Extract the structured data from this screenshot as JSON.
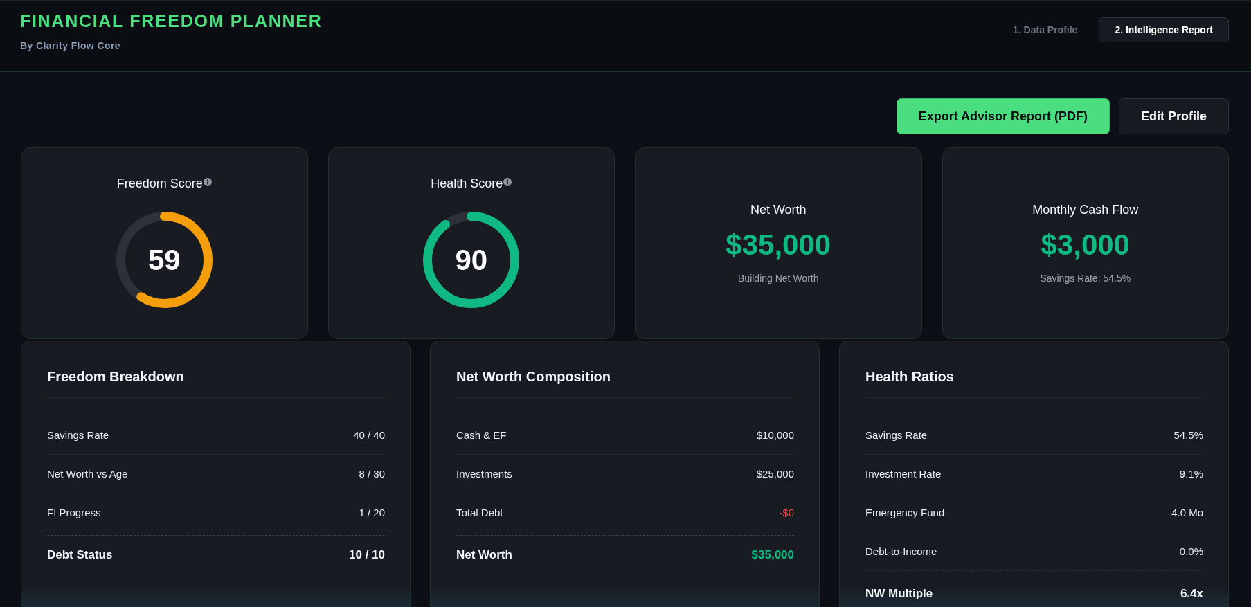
{
  "header": {
    "title": "FINANCIAL FREEDOM PLANNER",
    "subtitle": "By Clarity Flow Core"
  },
  "tabs": [
    {
      "label": "1. Data Profile",
      "selected": false
    },
    {
      "label": "2. Intelligence Report",
      "selected": true
    }
  ],
  "actions": [
    {
      "label": "Export Advisor Report (PDF)",
      "kind": "primary"
    },
    {
      "label": "Edit Profile",
      "kind": "secondary"
    }
  ],
  "score_cards": [
    {
      "kind": "gauge",
      "title": "Freedom Score",
      "info": true,
      "value": "59",
      "level": 0.59,
      "color": "#f59e0b"
    },
    {
      "kind": "gauge",
      "title": "Health Score",
      "info": true,
      "value": "90",
      "level": 0.9,
      "color": "#10b981"
    },
    {
      "kind": "stat",
      "title": "Net Worth",
      "value": "$35,000",
      "caption": "Building Net Worth"
    },
    {
      "kind": "stat",
      "title": "Monthly Cash Flow",
      "value": "$3,000",
      "caption": "Savings Rate: 54.5%"
    }
  ],
  "panels": [
    {
      "title": "Freedom Breakdown",
      "rows": [
        {
          "label": "Savings Rate",
          "value": "40 / 40",
          "negative": false
        },
        {
          "label": "Net Worth vs Age",
          "value": "8 / 30",
          "negative": false
        },
        {
          "label": "FI Progress",
          "value": "1 / 20",
          "negative": false
        }
      ],
      "total": {
        "label": "Debt Status",
        "value": "10 / 10",
        "positive": false
      }
    },
    {
      "title": "Net Worth Composition",
      "rows": [
        {
          "label": "Cash & EF",
          "value": "$10,000",
          "negative": false
        },
        {
          "label": "Investments",
          "value": "$25,000",
          "negative": false
        },
        {
          "label": "Total Debt",
          "value": "-$0",
          "negative": true
        }
      ],
      "total": {
        "label": "Net Worth",
        "value": "$35,000",
        "positive": true
      }
    },
    {
      "title": "Health Ratios",
      "rows": [
        {
          "label": "Savings Rate",
          "value": "54.5%",
          "negative": false
        },
        {
          "label": "Investment Rate",
          "value": "9.1%",
          "negative": false
        },
        {
          "label": "Emergency Fund",
          "value": "4.0 Mo",
          "negative": false
        },
        {
          "label": "Debt-to-Income",
          "value": "0.0%",
          "negative": false
        }
      ],
      "total": {
        "label": "NW Multiple",
        "value": "6.4x",
        "positive": false
      }
    }
  ]
}
